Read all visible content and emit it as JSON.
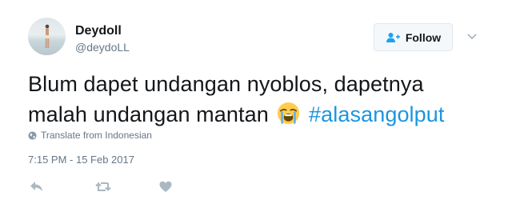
{
  "user": {
    "name": "Deydoll",
    "handle": "@deydoLL"
  },
  "follow_button": {
    "label": "Follow",
    "icon": "add-user-icon"
  },
  "menu": {
    "icon": "chevron-down-icon"
  },
  "tweet": {
    "line1": "Blum dapet undangan nyoblos, dapetnya",
    "line2": "malah undangan mantan",
    "emoji": "loudly-crying-face",
    "hashtag": "#alasangolput",
    "translate_label": "Translate from Indonesian",
    "timestamp": "7:15 PM - 15 Feb 2017"
  },
  "actions": {
    "reply": "reply-icon",
    "retweet": "retweet-icon",
    "like": "heart-icon"
  },
  "colors": {
    "hashtag": "#1b95e0",
    "secondary_text": "#657786",
    "icon": "#aab8c2"
  }
}
